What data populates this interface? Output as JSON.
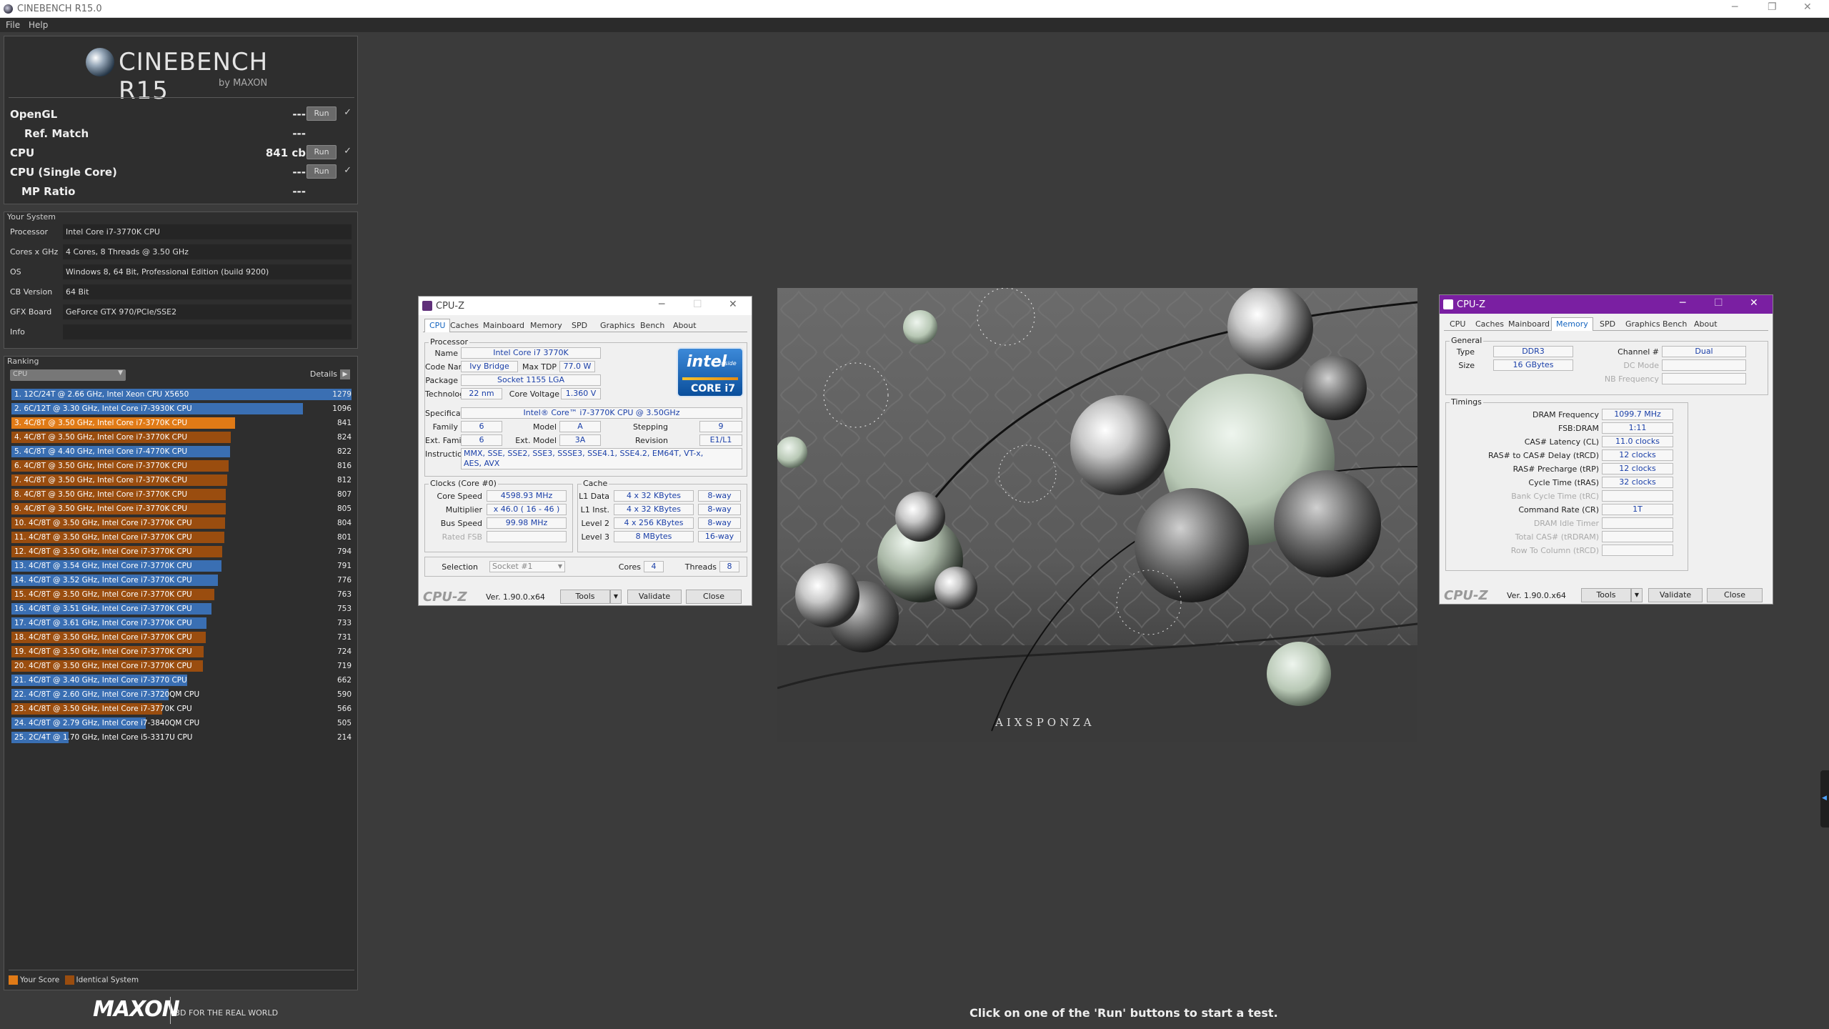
{
  "window": {
    "title": "CINEBENCH R15.0"
  },
  "menu": [
    "File",
    "Help"
  ],
  "logo": {
    "name": "CINEBENCH R15",
    "sub": "by MAXON"
  },
  "scores": [
    {
      "label": "OpenGL",
      "value": "---",
      "button": "Run",
      "check": "✓"
    },
    {
      "label": "Ref. Match",
      "value": "---"
    },
    {
      "label": "CPU",
      "value": "841 cb",
      "button": "Run",
      "check": "✓"
    },
    {
      "label": "CPU (Single Core)",
      "value": "---",
      "button": "Run",
      "check": "✓"
    },
    {
      "label": "MP Ratio",
      "value": "---"
    }
  ],
  "system": {
    "title": "Your System",
    "rows": [
      {
        "k": "Processor",
        "v": "Intel Core i7-3770K CPU"
      },
      {
        "k": "Cores x GHz",
        "v": "4 Cores, 8 Threads @ 3.50 GHz"
      },
      {
        "k": "OS",
        "v": "Windows 8, 64 Bit, Professional Edition (build 9200)"
      },
      {
        "k": "CB Version",
        "v": "64 Bit"
      },
      {
        "k": "GFX Board",
        "v": "GeForce GTX 970/PCIe/SSE2"
      },
      {
        "k": "Info",
        "v": ""
      }
    ]
  },
  "ranking": {
    "title": "Ranking",
    "dropdown": "CPU",
    "details": "Details",
    "legend": {
      "your_score": "Your Score",
      "identical": "Identical System",
      "your_color": "#e07a16",
      "identical_color": "#9a4d0f",
      "other_color": "#3a6fb3"
    },
    "rows": [
      {
        "text": "1. 12C/24T @ 2.66 GHz, Intel Xeon CPU X5650",
        "score": 1279,
        "kind": "other"
      },
      {
        "text": "2. 6C/12T @ 3.30 GHz,  Intel Core i7-3930K CPU",
        "score": 1096,
        "kind": "other"
      },
      {
        "text": "3. 4C/8T @ 3.50 GHz,  Intel Core i7-3770K CPU",
        "score": 841,
        "kind": "your"
      },
      {
        "text": "4. 4C/8T @ 3.50 GHz,  Intel Core i7-3770K CPU",
        "score": 824,
        "kind": "identical"
      },
      {
        "text": "5. 4C/8T @ 4.40 GHz, Intel Core i7-4770K CPU",
        "score": 822,
        "kind": "other"
      },
      {
        "text": "6. 4C/8T @ 3.50 GHz,  Intel Core i7-3770K CPU",
        "score": 816,
        "kind": "identical"
      },
      {
        "text": "7. 4C/8T @ 3.50 GHz,  Intel Core i7-3770K CPU",
        "score": 812,
        "kind": "identical"
      },
      {
        "text": "8. 4C/8T @ 3.50 GHz,  Intel Core i7-3770K CPU",
        "score": 807,
        "kind": "identical"
      },
      {
        "text": "9. 4C/8T @ 3.50 GHz,  Intel Core i7-3770K CPU",
        "score": 805,
        "kind": "identical"
      },
      {
        "text": "10. 4C/8T @ 3.50 GHz,  Intel Core i7-3770K CPU",
        "score": 804,
        "kind": "identical"
      },
      {
        "text": "11. 4C/8T @ 3.50 GHz,  Intel Core i7-3770K CPU",
        "score": 801,
        "kind": "identical"
      },
      {
        "text": "12. 4C/8T @ 3.50 GHz,  Intel Core i7-3770K CPU",
        "score": 794,
        "kind": "identical"
      },
      {
        "text": "13. 4C/8T @ 3.54 GHz,  Intel Core i7-3770K CPU",
        "score": 791,
        "kind": "other"
      },
      {
        "text": "14. 4C/8T @ 3.52 GHz,  Intel Core i7-3770K CPU",
        "score": 776,
        "kind": "other"
      },
      {
        "text": "15. 4C/8T @ 3.50 GHz,  Intel Core i7-3770K CPU",
        "score": 763,
        "kind": "identical"
      },
      {
        "text": "16. 4C/8T @ 3.51 GHz,  Intel Core i7-3770K CPU",
        "score": 753,
        "kind": "other"
      },
      {
        "text": "17. 4C/8T @ 3.61 GHz,  Intel Core i7-3770K CPU",
        "score": 733,
        "kind": "other"
      },
      {
        "text": "18. 4C/8T @ 3.50 GHz,  Intel Core i7-3770K CPU",
        "score": 731,
        "kind": "identical"
      },
      {
        "text": "19. 4C/8T @ 3.50 GHz,  Intel Core i7-3770K CPU",
        "score": 724,
        "kind": "identical"
      },
      {
        "text": "20. 4C/8T @ 3.50 GHz,  Intel Core i7-3770K CPU",
        "score": 719,
        "kind": "identical"
      },
      {
        "text": "21. 4C/8T @ 3.40 GHz,  Intel Core i7-3770 CPU",
        "score": 662,
        "kind": "other"
      },
      {
        "text": "22. 4C/8T @ 2.60 GHz, Intel Core i7-3720QM CPU",
        "score": 590,
        "kind": "other"
      },
      {
        "text": "23. 4C/8T @ 3.50 GHz,  Intel Core i7-3770K CPU",
        "score": 566,
        "kind": "identical"
      },
      {
        "text": "24. 4C/8T @ 2.79 GHz, Intel Core i7-3840QM CPU",
        "score": 505,
        "kind": "other"
      },
      {
        "text": "25. 2C/4T @ 1.70 GHz,  Intel Core i5-3317U CPU",
        "score": 214,
        "kind": "other"
      }
    ]
  },
  "footer": {
    "brand": "MAXON",
    "tagline": "3D FOR THE REAL WORLD",
    "message": "Click on one of the 'Run' buttons to start a test."
  },
  "render": {
    "watermark": "AIXSPONZA"
  },
  "cpuz1": {
    "title": "CPU-Z",
    "tabs": [
      "CPU",
      "Caches",
      "Mainboard",
      "Memory",
      "SPD",
      "Graphics",
      "Bench",
      "About"
    ],
    "processor_title": "Processor",
    "name_l": "Name",
    "name": "Intel Core i7 3770K",
    "codename_l": "Code Name",
    "codename": "Ivy Bridge",
    "tdp_l": "Max TDP",
    "tdp": "77.0 W",
    "package_l": "Package",
    "package": "Socket 1155 LGA",
    "tech_l": "Technology",
    "tech": "22 nm",
    "volt_l": "Core Voltage",
    "volt": "1.360 V",
    "spec_l": "Specification",
    "spec": "Intel® Core™ i7-3770K CPU @ 3.50GHz",
    "family_l": "Family",
    "family": "6",
    "model_l": "Model",
    "model": "A",
    "stepping_l": "Stepping",
    "stepping": "9",
    "extfamily_l": "Ext. Family",
    "extfamily": "6",
    "extmodel_l": "Ext. Model",
    "extmodel": "3A",
    "revision_l": "Revision",
    "revision": "E1/L1",
    "instr_l": "Instructions",
    "instr1": "MMX, SSE, SSE2, SSE3, SSSE3, SSE4.1, SSE4.2, EM64T, VT-x,",
    "instr2": "AES, AVX",
    "badge": {
      "brand": "intel",
      "inside": "inside",
      "line": "CORE i7"
    },
    "clocks_title": "Clocks (Core #0)",
    "corespeed_l": "Core Speed",
    "corespeed": "4598.93 MHz",
    "mult_l": "Multiplier",
    "mult": "x 46.0 ( 16 - 46 )",
    "bus_l": "Bus Speed",
    "bus": "99.98 MHz",
    "fsb_l": "Rated FSB",
    "fsb": "",
    "cache_title": "Cache",
    "l1d_l": "L1 Data",
    "l1d": "4 x 32 KBytes",
    "l1d_w": "8-way",
    "l1i_l": "L1 Inst.",
    "l1i": "4 x 32 KBytes",
    "l1i_w": "8-way",
    "l2_l": "Level 2",
    "l2": "4 x 256 KBytes",
    "l2_w": "8-way",
    "l3_l": "Level 3",
    "l3": "8 MBytes",
    "l3_w": "16-way",
    "selection_l": "Selection",
    "selection": "Socket #1",
    "cores_l": "Cores",
    "cores": "4",
    "threads_l": "Threads",
    "threads": "8",
    "brand": "CPU-Z",
    "version": "Ver. 1.90.0.x64",
    "tools": "Tools",
    "validate": "Validate",
    "close": "Close"
  },
  "cpuz2": {
    "title": "CPU-Z",
    "tabs": [
      "CPU",
      "Caches",
      "Mainboard",
      "Memory",
      "SPD",
      "Graphics",
      "Bench",
      "About"
    ],
    "general_title": "General",
    "type_l": "Type",
    "type": "DDR3",
    "size_l": "Size",
    "size": "16 GBytes",
    "channel_l": "Channel #",
    "channel": "Dual",
    "dcmode_l": "DC Mode",
    "dcmode": "",
    "nbfreq_l": "NB Frequency",
    "nbfreq": "",
    "timings_title": "Timings",
    "timings": [
      {
        "k": "DRAM Frequency",
        "v": "1099.7 MHz",
        "dim": false
      },
      {
        "k": "FSB:DRAM",
        "v": "1:11",
        "dim": false
      },
      {
        "k": "CAS# Latency (CL)",
        "v": "11.0 clocks",
        "dim": false
      },
      {
        "k": "RAS# to CAS# Delay (tRCD)",
        "v": "12 clocks",
        "dim": false
      },
      {
        "k": "RAS# Precharge (tRP)",
        "v": "12 clocks",
        "dim": false
      },
      {
        "k": "Cycle Time (tRAS)",
        "v": "32 clocks",
        "dim": false
      },
      {
        "k": "Bank Cycle Time (tRC)",
        "v": "",
        "dim": true
      },
      {
        "k": "Command Rate (CR)",
        "v": "1T",
        "dim": false
      },
      {
        "k": "DRAM Idle Timer",
        "v": "",
        "dim": true
      },
      {
        "k": "Total CAS# (tRDRAM)",
        "v": "",
        "dim": true
      },
      {
        "k": "Row To Column (tRCD)",
        "v": "",
        "dim": true
      }
    ],
    "brand": "CPU-Z",
    "version": "Ver. 1.90.0.x64",
    "tools": "Tools",
    "validate": "Validate",
    "close": "Close"
  }
}
